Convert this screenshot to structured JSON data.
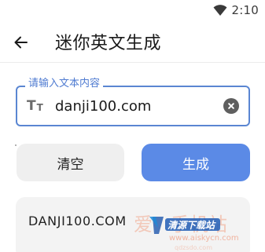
{
  "status_bar": {
    "time": "2:10",
    "wifi_icon": "wifi-icon"
  },
  "app_bar": {
    "title": "迷你英文生成",
    "back_icon": "arrow-left-icon"
  },
  "input": {
    "label": "请输入文本内容",
    "value": "danji100.com",
    "leading_icon": "text-type-icon",
    "clear_icon": "clear-circle-icon",
    "accent_color": "#5a86d2"
  },
  "buttons": {
    "clear_label": "清空",
    "generate_label": "生成",
    "generate_color": "#5b8ae6"
  },
  "result": {
    "text": "DANJI100.COM"
  },
  "watermark": {
    "main": "爱   手机站",
    "logo_text": "清源下载站",
    "url": "www.aiskycn.com",
    "sub_url": "qdzsdo.com"
  }
}
